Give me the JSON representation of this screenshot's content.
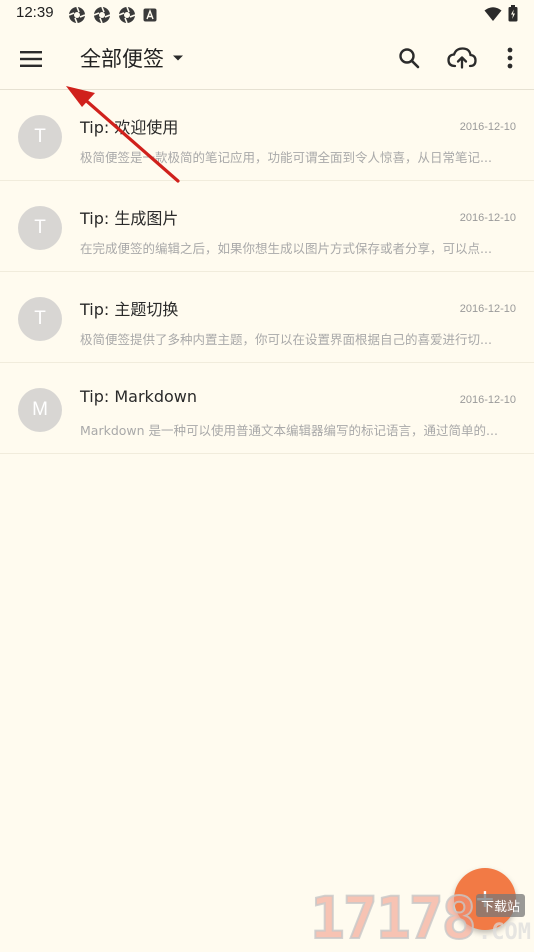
{
  "status_bar": {
    "time": "12:39",
    "left_icons": [
      "aperture-icon",
      "aperture-icon",
      "aperture-icon",
      "a-box-icon"
    ],
    "right_icons": [
      "wifi-icon",
      "battery-icon"
    ]
  },
  "app_bar": {
    "title": "全部便签",
    "icons": [
      "menu-icon",
      "dropdown-arrow-icon",
      "search-icon",
      "cloud-sync-icon",
      "more-vert-icon"
    ]
  },
  "notes": [
    {
      "avatar": "T",
      "title": "Tip: 欢迎使用",
      "date": "2016-12-10",
      "preview": "极简便签是一款极简的笔记应用，功能可谓全面到令人惊喜，从日常笔记..."
    },
    {
      "avatar": "T",
      "title": "Tip: 生成图片",
      "date": "2016-12-10",
      "preview": "在完成便签的编辑之后，如果你想生成以图片方式保存或者分享，可以点..."
    },
    {
      "avatar": "T",
      "title": "Tip: 主题切换",
      "date": "2016-12-10",
      "preview": "极简便签提供了多种内置主题，你可以在设置界面根据自己的喜爱进行切..."
    },
    {
      "avatar": "M",
      "title": "Tip: Markdown",
      "date": "2016-12-10",
      "preview": "Markdown 是一种可以使用普通文本编辑器编写的标记语言，通过简单的..."
    }
  ],
  "fab": {
    "label": "+"
  },
  "watermark": {
    "digits": "17178",
    "badge": "下载站",
    "suffix": ".COM"
  },
  "colors": {
    "background": "#fffbef",
    "accent": "#f27a45",
    "avatar": "#d8d6d3",
    "annotation_arrow": "#d0211c"
  }
}
